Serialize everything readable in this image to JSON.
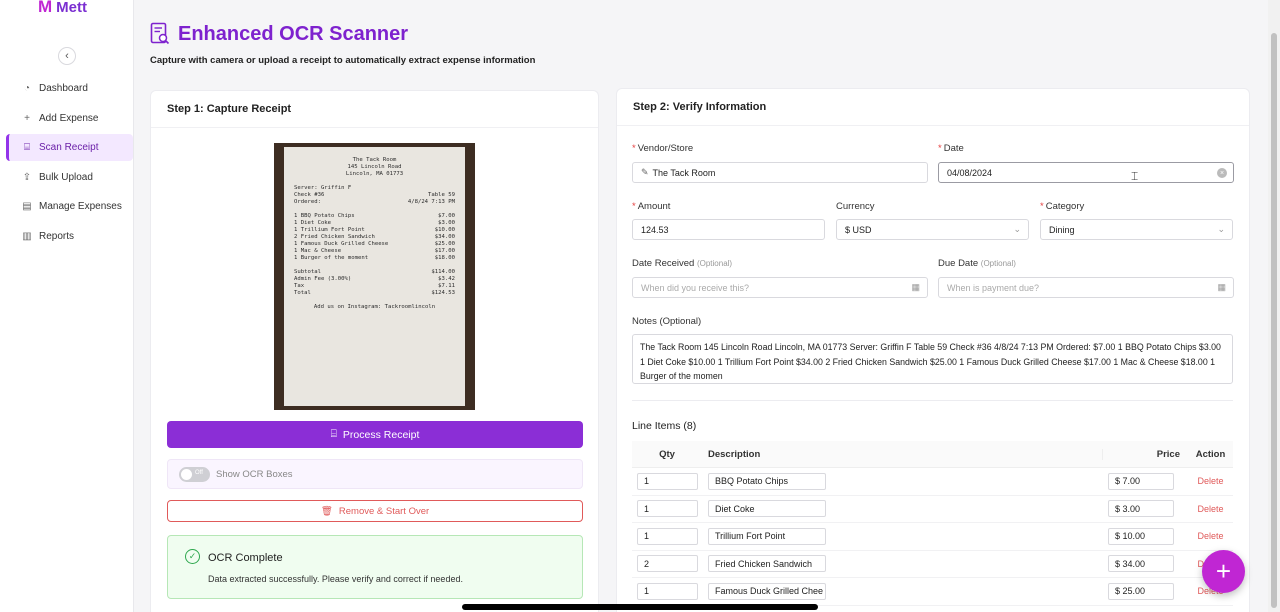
{
  "app": {
    "logo_mark": "M",
    "logo_text": "Mett"
  },
  "sidebar": {
    "collapse_icon": "chevron-left-icon",
    "items": [
      {
        "label": "Dashboard",
        "icon": "dashboard-icon"
      },
      {
        "label": "Add Expense",
        "icon": "plus-icon"
      },
      {
        "label": "Scan Receipt",
        "icon": "scan-icon",
        "active": true
      },
      {
        "label": "Bulk Upload",
        "icon": "upload-icon"
      },
      {
        "label": "Manage Expenses",
        "icon": "file-icon"
      },
      {
        "label": "Reports",
        "icon": "bar-chart-icon"
      }
    ]
  },
  "header": {
    "title": "Enhanced OCR Scanner",
    "subtitle": "Capture with camera or upload a receipt to automatically extract expense information"
  },
  "step1": {
    "title": "Step 1: Capture Receipt",
    "receipt": {
      "name": "The Tack Room",
      "addr1": "145 Lincoln Road",
      "addr2": "Lincoln, MA 01773",
      "server": "Server: Griffin F",
      "check": "Check #36",
      "table": "Table 59",
      "ordered": "Ordered:",
      "datetime": "4/8/24 7:13 PM",
      "lines": [
        {
          "item": "1 BBQ Potato Chips",
          "price": "$7.00"
        },
        {
          "item": "1 Diet Coke",
          "price": "$3.00"
        },
        {
          "item": "1 Trillium Fort Point",
          "price": "$10.00"
        },
        {
          "item": "2 Fried Chicken Sandwich",
          "price": "$34.00"
        },
        {
          "item": "1 Famous Duck Grilled Cheese",
          "price": "$25.00"
        },
        {
          "item": "1 Mac & Cheese",
          "price": "$17.00"
        },
        {
          "item": "1 Burger of the moment",
          "price": "$18.00"
        }
      ],
      "subtotal_label": "Subtotal",
      "subtotal": "$114.00",
      "admin_label": "Admin Fee (3.00%)",
      "admin": "$3.42",
      "tax_label": "Tax",
      "tax": "$7.11",
      "total_label": "Total",
      "total": "$124.53",
      "footer": "Add us on Instagram: Tackroomlincoln"
    },
    "process_label": "Process Receipt",
    "toggle_text": "Off",
    "toggle_label": "Show OCR Boxes",
    "remove_label": "Remove & Start Over",
    "ocr_title": "OCR Complete",
    "ocr_message": "Data extracted successfully. Please verify and correct if needed."
  },
  "step2": {
    "title": "Step 2: Verify Information",
    "required_mark": "*",
    "vendor_label": "Vendor/Store",
    "vendor_value": "The Tack Room",
    "date_label": "Date",
    "date_value": "04/08/2024",
    "amount_label": "Amount",
    "amount_value": "124.53",
    "currency_label": "Currency",
    "currency_value": "$ USD",
    "category_label": "Category",
    "category_value": "Dining",
    "date_received_label": "Date Received",
    "optional_text": "(Optional)",
    "date_received_placeholder": "When did you receive this?",
    "due_date_label": "Due Date",
    "due_date_placeholder": "When is payment due?",
    "notes_label": "Notes (Optional)",
    "notes_value": "The Tack Room 145 Lincoln Road Lincoln, MA 01773 Server: Griffin F Table 59 Check #36 4/8/24 7:13 PM Ordered: $7.00 1 BBQ Potato Chips $3.00 1 Diet Coke $10.00 1 Trillium Fort Point $34.00 2 Fried Chicken Sandwich $25.00 1 Famous Duck Grilled Cheese $17.00 1 Mac & Cheese $18.00 1 Burger of the momen",
    "line_items_title": "Line Items (8)",
    "columns": {
      "qty": "Qty",
      "description": "Description",
      "price": "Price",
      "action": "Action"
    },
    "line_items": [
      {
        "qty": "1",
        "description": "BBQ Potato Chips",
        "price": "$ 7.00",
        "action": "Delete"
      },
      {
        "qty": "1",
        "description": "Diet Coke",
        "price": "$ 3.00",
        "action": "Delete"
      },
      {
        "qty": "1",
        "description": "Trillium Fort Point",
        "price": "$ 10.00",
        "action": "Delete"
      },
      {
        "qty": "2",
        "description": "Fried Chicken Sandwich",
        "price": "$ 34.00",
        "action": "Delete"
      },
      {
        "qty": "1",
        "description": "Famous Duck Grilled Chee",
        "price": "$ 25.00",
        "action": "Delete"
      }
    ]
  },
  "fab_label": "+",
  "colors": {
    "brand": "#7e22ce",
    "accent": "#c026d3",
    "primary_button": "#8b2ed6",
    "danger": "#e05a5a",
    "success": "#2fa84f"
  }
}
